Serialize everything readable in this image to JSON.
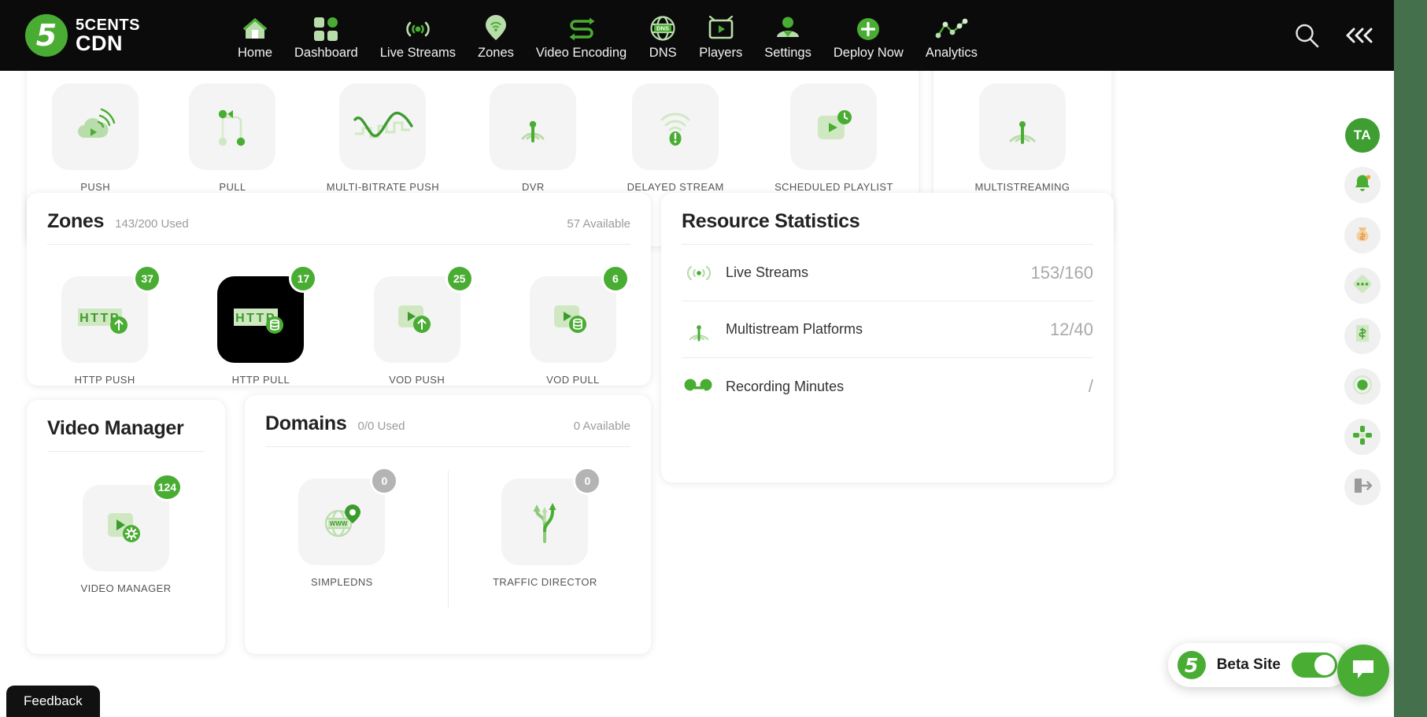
{
  "brand": {
    "line1": "5CENTS",
    "line2": "CDN",
    "mark": "5"
  },
  "nav": {
    "items": [
      {
        "label": "Home",
        "icon": "home-icon"
      },
      {
        "label": "Dashboard",
        "icon": "grid-icon"
      },
      {
        "label": "Live Streams",
        "icon": "broadcast-icon"
      },
      {
        "label": "Zones",
        "icon": "map-pin-wifi-icon"
      },
      {
        "label": "Video Encoding",
        "icon": "transcode-arrows-icon"
      },
      {
        "label": "DNS",
        "icon": "globe-dns-icon"
      },
      {
        "label": "Players",
        "icon": "tv-play-icon"
      },
      {
        "label": "Settings",
        "icon": "user-icon"
      },
      {
        "label": "Deploy Now",
        "icon": "plus-circle-icon"
      },
      {
        "label": "Analytics",
        "icon": "line-chart-icon"
      }
    ],
    "search_icon": "search-icon",
    "collapse_icon": "chevrons-left-icon"
  },
  "live_tiles": {
    "row": [
      {
        "label": "PUSH",
        "icon": "cloud-push-icon"
      },
      {
        "label": "PULL",
        "icon": "pull-nodes-icon"
      },
      {
        "label": "MULTI-BITRATE PUSH",
        "icon": "multibitrate-wave-icon"
      },
      {
        "label": "DVR",
        "icon": "dvr-antenna-icon"
      },
      {
        "label": "DELAYED STREAM",
        "icon": "delayed-wifi-icon"
      },
      {
        "label": "SCHEDULED PLAYLIST",
        "icon": "playlist-clock-icon"
      }
    ],
    "aside": [
      {
        "label": "MULTISTREAMING",
        "icon": "multistream-antenna-icon"
      }
    ]
  },
  "zones": {
    "title": "Zones",
    "used": "143/200 Used",
    "available": "57 Available",
    "tiles": [
      {
        "label": "HTTP PUSH",
        "badge": "37",
        "icon": "http-push-icon",
        "selected": false
      },
      {
        "label": "HTTP PULL",
        "badge": "17",
        "icon": "http-pull-icon",
        "selected": true
      },
      {
        "label": "VOD PUSH",
        "badge": "25",
        "icon": "vod-push-icon",
        "selected": false
      },
      {
        "label": "VOD PULL",
        "badge": "6",
        "icon": "vod-pull-icon",
        "selected": false
      }
    ]
  },
  "resource_statistics": {
    "title": "Resource Statistics",
    "rows": [
      {
        "label": "Live Streams",
        "value": "153/160",
        "icon": "broadcast-icon"
      },
      {
        "label": "Multistream Platforms",
        "value": "12/40",
        "icon": "multistream-antenna-icon"
      },
      {
        "label": "Recording Minutes",
        "value": "/",
        "icon": "record-dots-icon"
      }
    ]
  },
  "video_manager": {
    "title": "Video Manager",
    "tiles": [
      {
        "label": "VIDEO MANAGER",
        "badge": "124",
        "icon": "video-gear-icon"
      }
    ]
  },
  "domains": {
    "title": "Domains",
    "used": "0/0 Used",
    "available": "0 Available",
    "tiles": [
      {
        "label": "SIMPLEDNS",
        "badge": "0",
        "icon": "www-globe-pin-icon",
        "badge_grey": true
      },
      {
        "label": "TRAFFIC DIRECTOR",
        "badge": "0",
        "icon": "traffic-split-icon",
        "badge_grey": true
      }
    ]
  },
  "float_toolbar": {
    "avatar": "TA",
    "buttons": [
      {
        "icon": "bell-icon",
        "name": "notifications-button"
      },
      {
        "icon": "money-bag-icon",
        "name": "billing-balance-button"
      },
      {
        "icon": "diamond-dots-icon",
        "name": "more-options-button"
      },
      {
        "icon": "receipt-dollar-icon",
        "name": "invoices-button"
      },
      {
        "icon": "record-circle-icon",
        "name": "recording-button"
      },
      {
        "icon": "move-arrows-icon",
        "name": "drag-handle-button"
      },
      {
        "icon": "logout-icon",
        "name": "logout-button"
      }
    ]
  },
  "beta": {
    "label": "Beta Site",
    "logo": "5",
    "toggle_on": true
  },
  "feedback": {
    "label": "Feedback"
  },
  "colors": {
    "brand_green": "#4aad33",
    "nav_bg": "#0b0b0b",
    "right_strip": "#44704c",
    "tile_bg": "#f4f4f4",
    "muted_text": "#9b9b9b"
  }
}
